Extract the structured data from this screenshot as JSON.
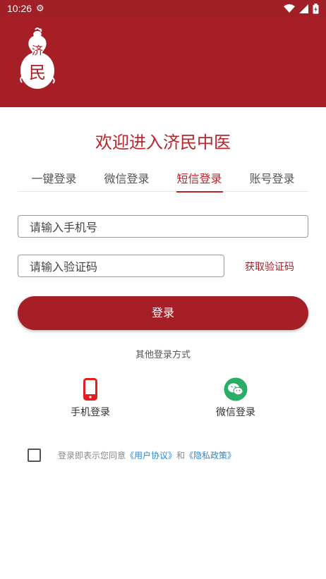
{
  "status_bar": {
    "time": "10:26"
  },
  "logo": {
    "text": "济民"
  },
  "welcome": "欢迎进入济民中医",
  "tabs": [
    {
      "label": "一键登录"
    },
    {
      "label": "微信登录"
    },
    {
      "label": "短信登录",
      "active": true
    },
    {
      "label": "账号登录"
    }
  ],
  "form": {
    "phone_placeholder": "请输入手机号",
    "code_placeholder": "请输入验证码",
    "get_code": "获取验证码",
    "login": "登录"
  },
  "other": {
    "title": "其他登录方式",
    "phone_login": "手机登录",
    "wechat_login": "微信登录"
  },
  "agreement": {
    "prefix": "登录即表示您同意",
    "user_agreement": "《用户协议》",
    "and": "和",
    "privacy": "《隐私政策》"
  },
  "colors": {
    "brand": "#a61f26",
    "link": "#2d86c9",
    "wechat": "#2aae67"
  },
  "icons": [
    "gear-icon",
    "wifi-icon",
    "signal-icon",
    "battery-icon",
    "mobile-phone-icon",
    "wechat-icon",
    "checkbox-icon"
  ]
}
